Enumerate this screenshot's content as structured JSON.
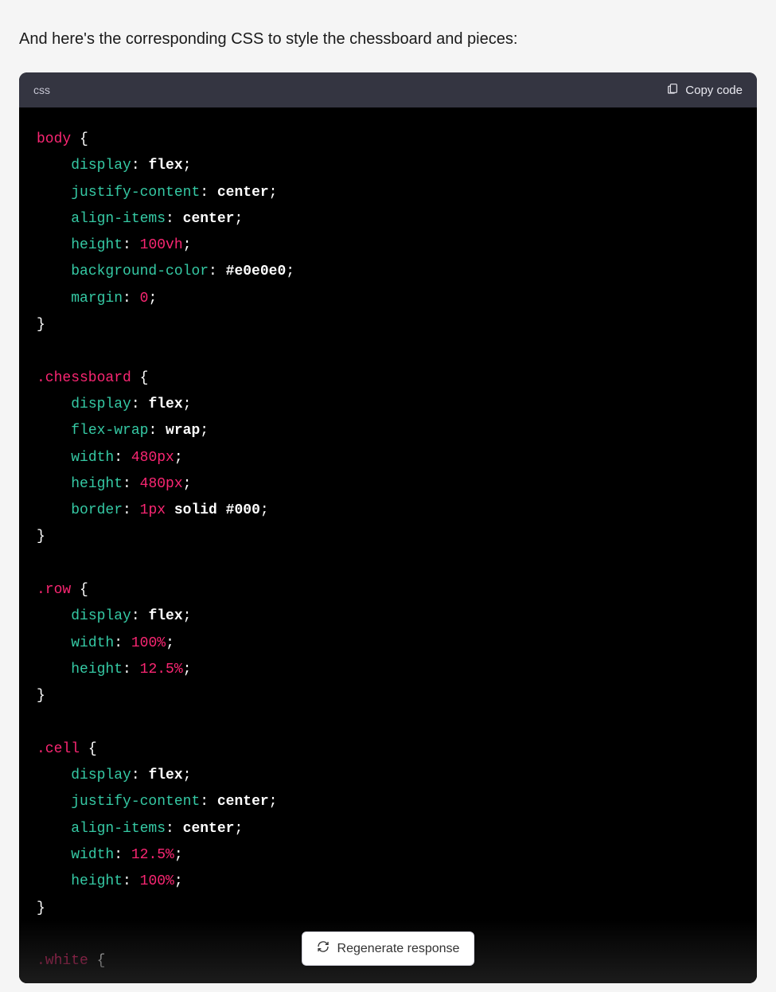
{
  "intro_text": "And here's the corresponding CSS to style the chessboard and pieces:",
  "code": {
    "language": "css",
    "copy_label": "Copy code",
    "tokens": [
      [
        {
          "t": "body ",
          "c": "sel"
        },
        {
          "t": "{",
          "c": "punct"
        }
      ],
      [
        {
          "t": "    ",
          "c": ""
        },
        {
          "t": "display",
          "c": "prop"
        },
        {
          "t": ": ",
          "c": "punct"
        },
        {
          "t": "flex",
          "c": "val"
        },
        {
          "t": ";",
          "c": "punct"
        }
      ],
      [
        {
          "t": "    ",
          "c": ""
        },
        {
          "t": "justify-content",
          "c": "prop"
        },
        {
          "t": ": ",
          "c": "punct"
        },
        {
          "t": "center",
          "c": "val"
        },
        {
          "t": ";",
          "c": "punct"
        }
      ],
      [
        {
          "t": "    ",
          "c": ""
        },
        {
          "t": "align-items",
          "c": "prop"
        },
        {
          "t": ": ",
          "c": "punct"
        },
        {
          "t": "center",
          "c": "val"
        },
        {
          "t": ";",
          "c": "punct"
        }
      ],
      [
        {
          "t": "    ",
          "c": ""
        },
        {
          "t": "height",
          "c": "prop"
        },
        {
          "t": ": ",
          "c": "punct"
        },
        {
          "t": "100vh",
          "c": "num"
        },
        {
          "t": ";",
          "c": "punct"
        }
      ],
      [
        {
          "t": "    ",
          "c": ""
        },
        {
          "t": "background-color",
          "c": "prop"
        },
        {
          "t": ": ",
          "c": "punct"
        },
        {
          "t": "#e0e0e0",
          "c": "hex"
        },
        {
          "t": ";",
          "c": "punct"
        }
      ],
      [
        {
          "t": "    ",
          "c": ""
        },
        {
          "t": "margin",
          "c": "prop"
        },
        {
          "t": ": ",
          "c": "punct"
        },
        {
          "t": "0",
          "c": "num"
        },
        {
          "t": ";",
          "c": "punct"
        }
      ],
      [
        {
          "t": "}",
          "c": "punct"
        }
      ],
      [
        {
          "t": "",
          "c": ""
        }
      ],
      [
        {
          "t": ".chessboard",
          "c": "sel"
        },
        {
          "t": " {",
          "c": "punct"
        }
      ],
      [
        {
          "t": "    ",
          "c": ""
        },
        {
          "t": "display",
          "c": "prop"
        },
        {
          "t": ": ",
          "c": "punct"
        },
        {
          "t": "flex",
          "c": "val"
        },
        {
          "t": ";",
          "c": "punct"
        }
      ],
      [
        {
          "t": "    ",
          "c": ""
        },
        {
          "t": "flex-wrap",
          "c": "prop"
        },
        {
          "t": ": ",
          "c": "punct"
        },
        {
          "t": "wrap",
          "c": "val"
        },
        {
          "t": ";",
          "c": "punct"
        }
      ],
      [
        {
          "t": "    ",
          "c": ""
        },
        {
          "t": "width",
          "c": "prop"
        },
        {
          "t": ": ",
          "c": "punct"
        },
        {
          "t": "480px",
          "c": "num"
        },
        {
          "t": ";",
          "c": "punct"
        }
      ],
      [
        {
          "t": "    ",
          "c": ""
        },
        {
          "t": "height",
          "c": "prop"
        },
        {
          "t": ": ",
          "c": "punct"
        },
        {
          "t": "480px",
          "c": "num"
        },
        {
          "t": ";",
          "c": "punct"
        }
      ],
      [
        {
          "t": "    ",
          "c": ""
        },
        {
          "t": "border",
          "c": "prop"
        },
        {
          "t": ": ",
          "c": "punct"
        },
        {
          "t": "1px",
          "c": "num"
        },
        {
          "t": " solid ",
          "c": "val"
        },
        {
          "t": "#000",
          "c": "hex"
        },
        {
          "t": ";",
          "c": "punct"
        }
      ],
      [
        {
          "t": "}",
          "c": "punct"
        }
      ],
      [
        {
          "t": "",
          "c": ""
        }
      ],
      [
        {
          "t": ".row",
          "c": "sel"
        },
        {
          "t": " {",
          "c": "punct"
        }
      ],
      [
        {
          "t": "    ",
          "c": ""
        },
        {
          "t": "display",
          "c": "prop"
        },
        {
          "t": ": ",
          "c": "punct"
        },
        {
          "t": "flex",
          "c": "val"
        },
        {
          "t": ";",
          "c": "punct"
        }
      ],
      [
        {
          "t": "    ",
          "c": ""
        },
        {
          "t": "width",
          "c": "prop"
        },
        {
          "t": ": ",
          "c": "punct"
        },
        {
          "t": "100%",
          "c": "num"
        },
        {
          "t": ";",
          "c": "punct"
        }
      ],
      [
        {
          "t": "    ",
          "c": ""
        },
        {
          "t": "height",
          "c": "prop"
        },
        {
          "t": ": ",
          "c": "punct"
        },
        {
          "t": "12.5%",
          "c": "num"
        },
        {
          "t": ";",
          "c": "punct"
        }
      ],
      [
        {
          "t": "}",
          "c": "punct"
        }
      ],
      [
        {
          "t": "",
          "c": ""
        }
      ],
      [
        {
          "t": ".cell",
          "c": "sel"
        },
        {
          "t": " {",
          "c": "punct"
        }
      ],
      [
        {
          "t": "    ",
          "c": ""
        },
        {
          "t": "display",
          "c": "prop"
        },
        {
          "t": ": ",
          "c": "punct"
        },
        {
          "t": "flex",
          "c": "val"
        },
        {
          "t": ";",
          "c": "punct"
        }
      ],
      [
        {
          "t": "    ",
          "c": ""
        },
        {
          "t": "justify-content",
          "c": "prop"
        },
        {
          "t": ": ",
          "c": "punct"
        },
        {
          "t": "center",
          "c": "val"
        },
        {
          "t": ";",
          "c": "punct"
        }
      ],
      [
        {
          "t": "    ",
          "c": ""
        },
        {
          "t": "align-items",
          "c": "prop"
        },
        {
          "t": ": ",
          "c": "punct"
        },
        {
          "t": "center",
          "c": "val"
        },
        {
          "t": ";",
          "c": "punct"
        }
      ],
      [
        {
          "t": "    ",
          "c": ""
        },
        {
          "t": "width",
          "c": "prop"
        },
        {
          "t": ": ",
          "c": "punct"
        },
        {
          "t": "12.5%",
          "c": "num"
        },
        {
          "t": ";",
          "c": "punct"
        }
      ],
      [
        {
          "t": "    ",
          "c": ""
        },
        {
          "t": "height",
          "c": "prop"
        },
        {
          "t": ": ",
          "c": "punct"
        },
        {
          "t": "100%",
          "c": "num"
        },
        {
          "t": ";",
          "c": "punct"
        }
      ],
      [
        {
          "t": "}",
          "c": "punct"
        }
      ],
      [
        {
          "t": "",
          "c": ""
        }
      ],
      [
        {
          "t": ".white",
          "c": "sel"
        },
        {
          "t": " {",
          "c": "punct"
        }
      ]
    ]
  },
  "regenerate_label": "Regenerate response"
}
